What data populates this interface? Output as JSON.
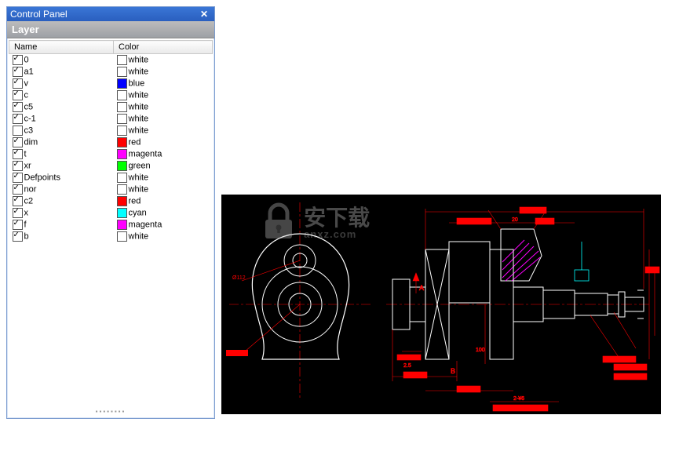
{
  "panel": {
    "title": "Control Panel",
    "close_glyph": "✕",
    "section": "Layer",
    "columns": {
      "name": "Name",
      "color": "Color"
    },
    "layers": [
      {
        "name": "0",
        "checked": true,
        "color": "white",
        "hex": "#ffffff"
      },
      {
        "name": "a1",
        "checked": true,
        "color": "white",
        "hex": "#ffffff"
      },
      {
        "name": "v",
        "checked": true,
        "color": "blue",
        "hex": "#0000ff"
      },
      {
        "name": "c",
        "checked": true,
        "color": "white",
        "hex": "#ffffff"
      },
      {
        "name": "c5",
        "checked": true,
        "color": "white",
        "hex": "#ffffff"
      },
      {
        "name": "c-1",
        "checked": true,
        "color": "white",
        "hex": "#ffffff"
      },
      {
        "name": "c3",
        "checked": false,
        "color": "white",
        "hex": "#ffffff"
      },
      {
        "name": "dim",
        "checked": true,
        "color": "red",
        "hex": "#ff0000"
      },
      {
        "name": "t",
        "checked": true,
        "color": "magenta",
        "hex": "#ff00ff"
      },
      {
        "name": "xr",
        "checked": true,
        "color": "green",
        "hex": "#00ff00"
      },
      {
        "name": "Defpoints",
        "checked": true,
        "color": "white",
        "hex": "#ffffff"
      },
      {
        "name": "nor",
        "checked": true,
        "color": "white",
        "hex": "#ffffff"
      },
      {
        "name": "c2",
        "checked": true,
        "color": "red",
        "hex": "#ff0000"
      },
      {
        "name": "x",
        "checked": true,
        "color": "cyan",
        "hex": "#00ffff"
      },
      {
        "name": "f",
        "checked": true,
        "color": "magenta",
        "hex": "#ff00ff"
      },
      {
        "name": "b",
        "checked": true,
        "color": "white",
        "hex": "#ffffff"
      }
    ]
  },
  "watermark": {
    "main": "安下载",
    "sub": "anxz.com"
  },
  "cad": {
    "callouts": [
      "2-¥6",
      "100",
      "20",
      "A",
      "B"
    ]
  }
}
